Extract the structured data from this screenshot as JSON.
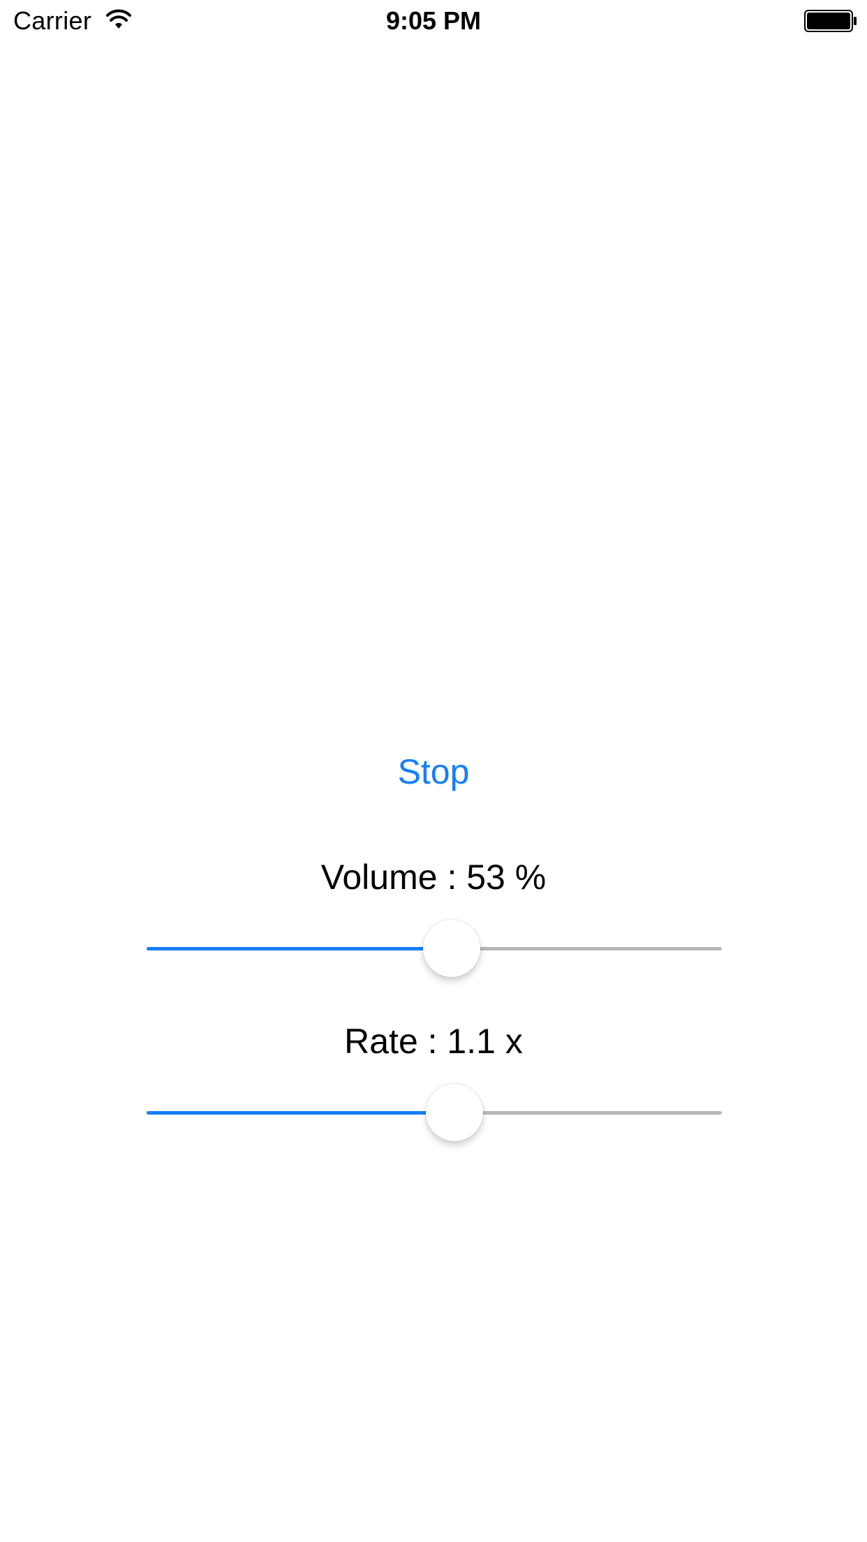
{
  "status_bar": {
    "carrier": "Carrier",
    "time": "9:05 PM",
    "wifi_icon": "wifi-icon",
    "battery_icon": "battery-full-icon"
  },
  "controls": {
    "stop_label": "Stop",
    "volume": {
      "label": "Volume : 53 %",
      "value": 0.53
    },
    "rate": {
      "label": "Rate : 1.1 x",
      "fraction": 0.535
    }
  },
  "colors": {
    "accent": "#147efb",
    "track_max": "#b6b6b6",
    "background": "#ffffff"
  }
}
